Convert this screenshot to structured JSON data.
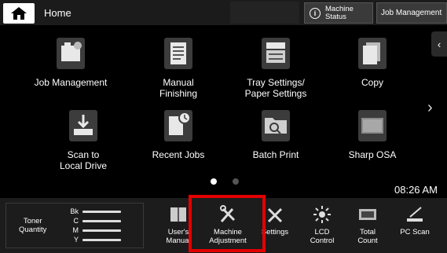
{
  "header": {
    "home_label": "Home",
    "machine_status_line1": "Machine",
    "machine_status_line2": "Status",
    "job_management_label": "Job Management"
  },
  "tiles": [
    {
      "line1": "Job Management",
      "line2": ""
    },
    {
      "line1": "Manual",
      "line2": "Finishing"
    },
    {
      "line1": "Tray Settings/",
      "line2": "Paper Settings"
    },
    {
      "line1": "Copy",
      "line2": ""
    },
    {
      "line1": "Scan to",
      "line2": "Local Drive"
    },
    {
      "line1": "Recent Jobs",
      "line2": ""
    },
    {
      "line1": "Batch Print",
      "line2": ""
    },
    {
      "line1": "Sharp OSA",
      "line2": ""
    }
  ],
  "pager": {
    "pages": 2,
    "current": 1
  },
  "clock": "08:26 AM",
  "toner": {
    "label_line1": "Toner",
    "label_line2": "Quantity",
    "channels": [
      {
        "key": "Bk",
        "level": 0.95
      },
      {
        "key": "C",
        "level": 0.95
      },
      {
        "key": "M",
        "level": 0.95
      },
      {
        "key": "Y",
        "level": 0.95
      }
    ]
  },
  "bottom_tools": [
    {
      "line1": "User's",
      "line2": "Manual"
    },
    {
      "line1": "Machine",
      "line2": "Adjustment"
    },
    {
      "line1": "Settings",
      "line2": ""
    },
    {
      "line1": "LCD",
      "line2": "Control"
    },
    {
      "line1": "Total",
      "line2": "Count"
    },
    {
      "line1": "PC Scan",
      "line2": ""
    }
  ],
  "colors": {
    "highlight": "#e30000",
    "background": "#000000",
    "bar": "#1c1c1c"
  }
}
